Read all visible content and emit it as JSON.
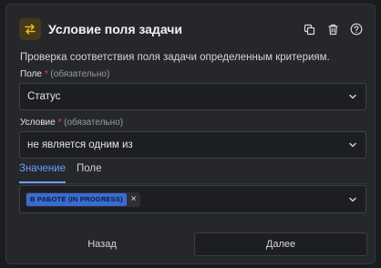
{
  "header": {
    "title": "Условие поля задачи",
    "icon": "swap-arrows-icon",
    "actions": [
      "copy-icon",
      "trash-icon",
      "help-icon"
    ]
  },
  "description": "Проверка соответствия поля задачи определенным критериям.",
  "field": {
    "label": "Поле",
    "required_mark": "*",
    "optional_note": "(обязательно)",
    "value": "Статус"
  },
  "condition": {
    "label": "Условие",
    "required_mark": "*",
    "optional_note": "(обязательно)",
    "value": "не является одним из"
  },
  "tabs": [
    {
      "label": "Значение",
      "active": true
    },
    {
      "label": "Поле",
      "active": false
    }
  ],
  "value_select": {
    "tags": [
      {
        "label": "В РАБОТЕ (IN PROGRESS)",
        "remove": "×"
      }
    ]
  },
  "buttons": {
    "back": "Назад",
    "next": "Далее"
  },
  "colors": {
    "accent": "#6e9cf6",
    "required": "#e5484d",
    "tag_bg": "#3a6bd2",
    "icon_bg": "#44391a",
    "icon_fg": "#f0b429"
  }
}
